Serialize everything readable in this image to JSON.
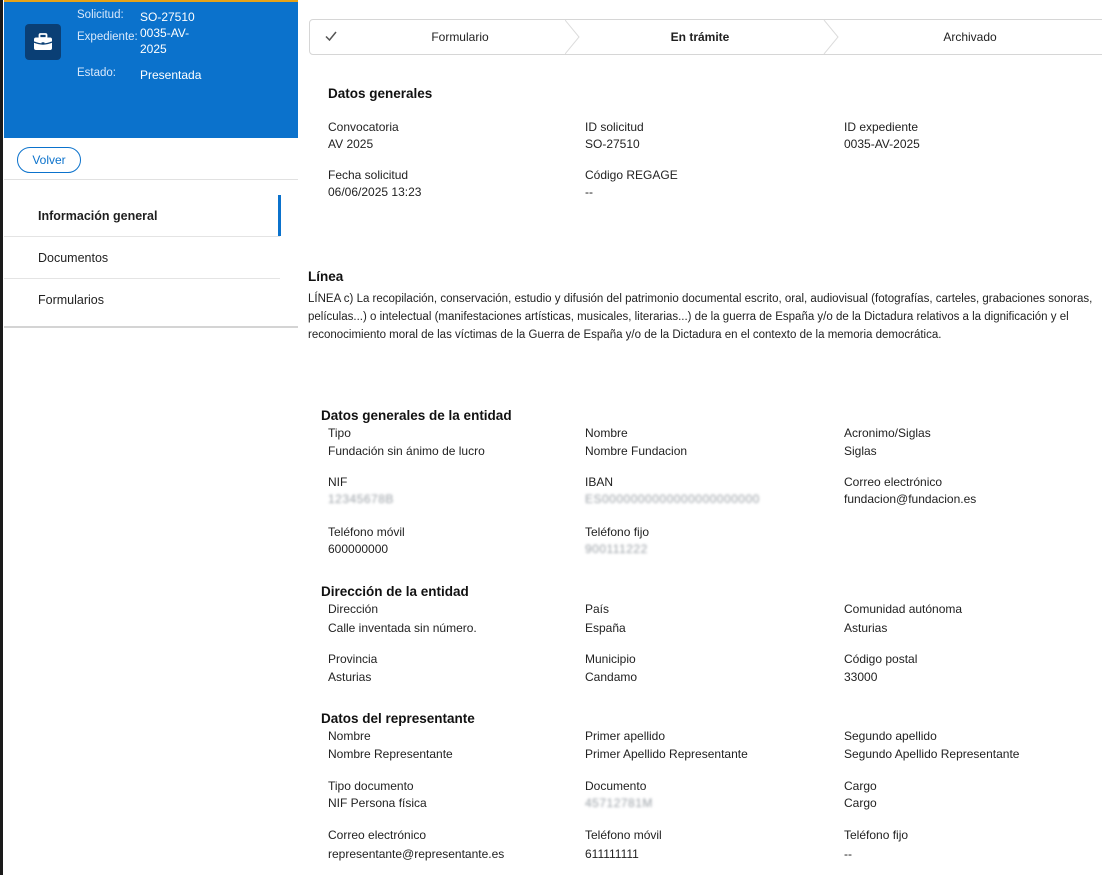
{
  "sidebar": {
    "info": {
      "solicitud_label": "Solicitud:",
      "solicitud_value": "SO-27510",
      "expediente_label": "Expediente:",
      "expediente_value": "0035-AV-2025",
      "estado_label": "Estado:",
      "estado_value": "Presentada"
    },
    "back_label": "Volver",
    "nav": [
      {
        "label": "Información general",
        "active": true
      },
      {
        "label": "Documentos",
        "active": false
      },
      {
        "label": "Formularios",
        "active": false
      }
    ]
  },
  "stepper": {
    "steps": [
      {
        "label": "Formulario",
        "state": "done"
      },
      {
        "label": "En trámite",
        "state": "current"
      },
      {
        "label": "Archivado",
        "state": "pending"
      }
    ]
  },
  "datos_generales": {
    "title": "Datos generales",
    "convocatoria_label": "Convocatoria",
    "convocatoria_value": "AV 2025",
    "id_solicitud_label": "ID solicitud",
    "id_solicitud_value": "SO-27510",
    "id_expediente_label": "ID expediente",
    "id_expediente_value": "0035-AV-2025",
    "fecha_label": "Fecha solicitud",
    "fecha_value": "06/06/2025 13:23",
    "regage_label": "Código REGAGE",
    "regage_value": "--"
  },
  "linea": {
    "title": "Línea",
    "text": "LÍNEA c) La recopilación, conservación, estudio y difusión del patrimonio documental escrito, oral, audiovisual (fotografías, carteles, grabaciones sonoras, películas...) o intelectual (manifestaciones artísticas, musicales, literarias...) de la guerra de España y/o de la Dictadura relativos a la dignificación y el reconocimiento moral de las víctimas de la Guerra de España y/o de la Dictadura en el contexto de la memoria democrática."
  },
  "entidad": {
    "title": "Datos generales de la entidad",
    "tipo_label": "Tipo",
    "tipo_value": "Fundación sin ánimo de lucro",
    "nombre_label": "Nombre",
    "nombre_value": "Nombre Fundacion",
    "acronimo_label": "Acronimo/Siglas",
    "acronimo_value": "Siglas",
    "nif_label": "NIF",
    "nif_value": "12345678B",
    "iban_label": "IBAN",
    "iban_value": "ES0000000000000000000000",
    "correo_label": "Correo electrónico",
    "correo_value": "fundacion@fundacion.es",
    "movil_label": "Teléfono móvil",
    "movil_value": "600000000",
    "fijo_label": "Teléfono fijo",
    "fijo_value": "900111222"
  },
  "direccion": {
    "title": "Dirección de la entidad",
    "direccion_label": "Dirección",
    "direccion_value": "Calle inventada sin número.",
    "pais_label": "País",
    "pais_value": "España",
    "comunidad_label": "Comunidad autónoma",
    "comunidad_value": "Asturias",
    "provincia_label": "Provincia",
    "provincia_value": "Asturias",
    "municipio_label": "Municipio",
    "municipio_value": "Candamo",
    "cp_label": "Código postal",
    "cp_value": "33000"
  },
  "representante": {
    "title": "Datos del representante",
    "nombre_label": "Nombre",
    "nombre_value": "Nombre Representante",
    "apellido1_label": "Primer apellido",
    "apellido1_value": "Primer Apellido Representante",
    "apellido2_label": "Segundo apellido",
    "apellido2_value": "Segundo Apellido Representante",
    "tipo_doc_label": "Tipo documento",
    "tipo_doc_value": "NIF Persona física",
    "documento_label": "Documento",
    "documento_value": "45712781M",
    "cargo_label": "Cargo",
    "cargo_value": "Cargo",
    "correo_label": "Correo electrónico",
    "correo_value": "representante@representante.es",
    "movil_label": "Teléfono móvil",
    "movil_value": "611111111",
    "fijo_label": "Teléfono fijo",
    "fijo_value": "--"
  },
  "icons": {
    "case": "briefcase-icon",
    "check": "check-icon"
  },
  "colors": {
    "header_blue": "#0b72cc",
    "dark_icon_bg": "#0a3f75",
    "accent_top": "#e8a317"
  }
}
